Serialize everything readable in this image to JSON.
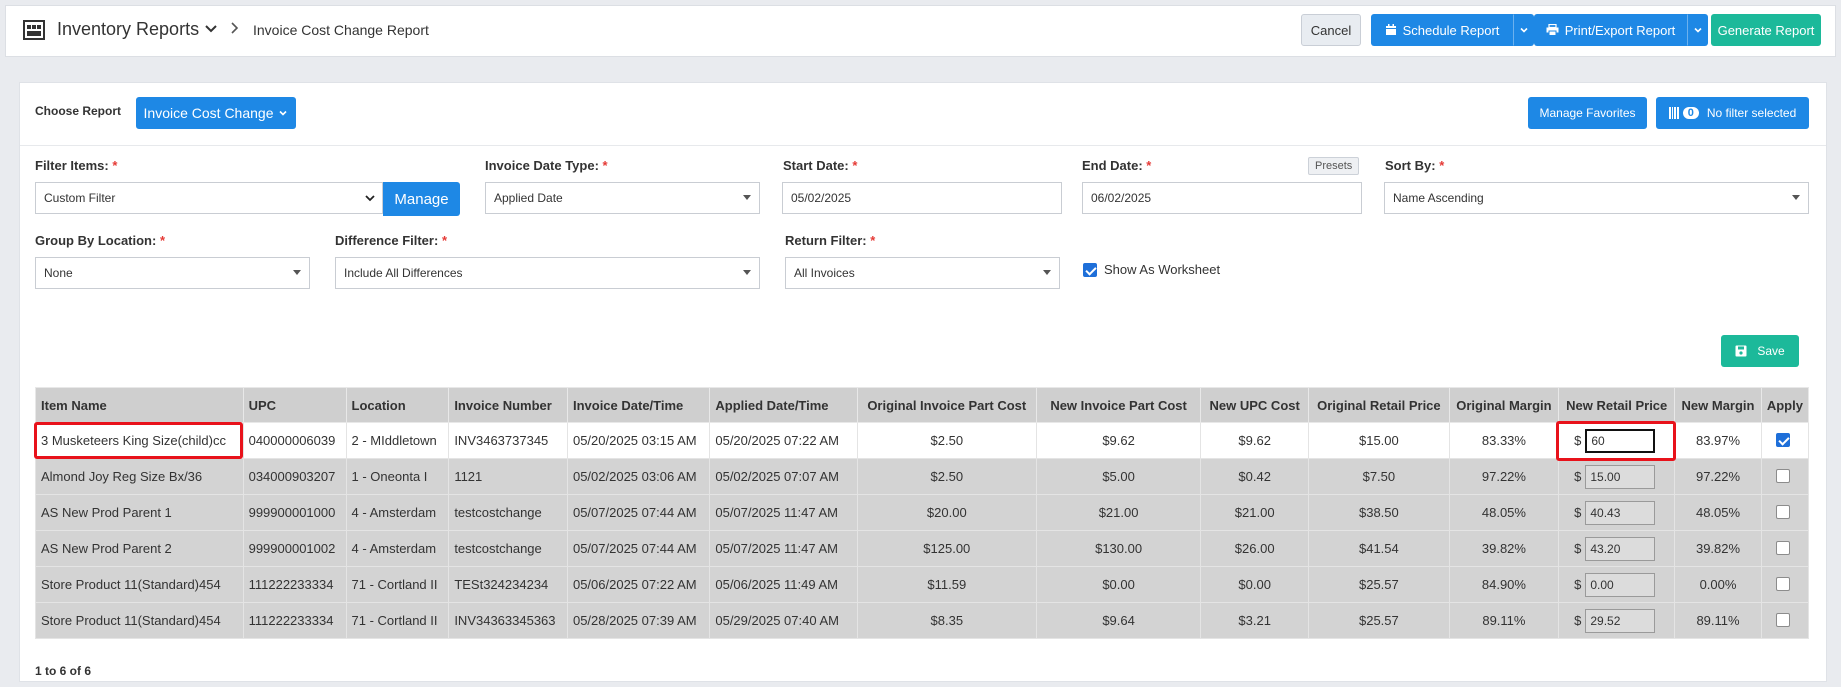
{
  "header": {
    "app_title": "Inventory Reports",
    "breadcrumb": "Invoice Cost Change Report",
    "cancel_label": "Cancel",
    "schedule_label": "Schedule Report",
    "print_label": "Print/Export Report",
    "generate_label": "Generate Report"
  },
  "report": {
    "choose_label": "Choose Report",
    "selected": "Invoice Cost Change",
    "manage_favorites": "Manage Favorites",
    "filter_count": "0",
    "filter_status": "No filter selected"
  },
  "filters": {
    "filter_items_label": "Filter Items:",
    "filter_items_value": "Custom Filter",
    "manage_label": "Manage",
    "invoice_date_type_label": "Invoice Date Type:",
    "invoice_date_type_value": "Applied Date",
    "start_date_label": "Start Date:",
    "start_date_value": "05/02/2025",
    "end_date_label": "End Date:",
    "end_date_value": "06/02/2025",
    "presets_label": "Presets",
    "sort_by_label": "Sort By:",
    "sort_by_value": "Name Ascending",
    "group_by_label": "Group By Location:",
    "group_by_value": "None",
    "difference_label": "Difference Filter:",
    "difference_value": "Include All Differences",
    "return_label": "Return Filter:",
    "return_value": "All Invoices",
    "worksheet_label": "Show As Worksheet",
    "required_mark": "*"
  },
  "save_label": "Save",
  "table": {
    "columns": [
      "Item Name",
      "UPC",
      "Location",
      "Invoice Number",
      "Invoice Date/Time",
      "Applied Date/Time",
      "Original Invoice Part Cost",
      "New Invoice Part Cost",
      "New UPC Cost",
      "Original Retail Price",
      "Original Margin",
      "New Retail Price",
      "New Margin",
      "Apply"
    ],
    "currency_symbol": "$",
    "rows": [
      {
        "item": "3 Musketeers King Size(child)cc",
        "upc": "040000006039",
        "location": "2 - MIddletown",
        "invoice": "INV3463737345",
        "invoice_dt": "05/20/2025 03:15 AM",
        "applied_dt": "05/20/2025 07:22 AM",
        "orig_cost": "$2.50",
        "new_cost": "$9.62",
        "upc_cost": "$9.62",
        "orig_retail": "$15.00",
        "orig_margin": "83.33%",
        "new_retail": "60",
        "new_margin": "83.97%",
        "apply": true
      },
      {
        "item": "Almond Joy Reg Size Bx/36",
        "upc": "034000903207",
        "location": "1 - Oneonta I",
        "invoice": "1121",
        "invoice_dt": "05/02/2025 03:06 AM",
        "applied_dt": "05/02/2025 07:07 AM",
        "orig_cost": "$2.50",
        "new_cost": "$5.00",
        "upc_cost": "$0.42",
        "orig_retail": "$7.50",
        "orig_margin": "97.22%",
        "new_retail": "15.00",
        "new_margin": "97.22%",
        "apply": false
      },
      {
        "item": "AS New Prod Parent 1",
        "upc": "999900001000",
        "location": "4 - Amsterdam",
        "invoice": "testcostchange",
        "invoice_dt": "05/07/2025 07:44 AM",
        "applied_dt": "05/07/2025 11:47 AM",
        "orig_cost": "$20.00",
        "new_cost": "$21.00",
        "upc_cost": "$21.00",
        "orig_retail": "$38.50",
        "orig_margin": "48.05%",
        "new_retail": "40.43",
        "new_margin": "48.05%",
        "apply": false
      },
      {
        "item": "AS New Prod Parent 2",
        "upc": "999900001002",
        "location": "4 - Amsterdam",
        "invoice": "testcostchange",
        "invoice_dt": "05/07/2025 07:44 AM",
        "applied_dt": "05/07/2025 11:47 AM",
        "orig_cost": "$125.00",
        "new_cost": "$130.00",
        "upc_cost": "$26.00",
        "orig_retail": "$41.54",
        "orig_margin": "39.82%",
        "new_retail": "43.20",
        "new_margin": "39.82%",
        "apply": false
      },
      {
        "item": "Store Product 11(Standard)454",
        "upc": "111222233334",
        "location": "71 - Cortland II",
        "invoice": "TESt324234234",
        "invoice_dt": "05/06/2025 07:22 AM",
        "applied_dt": "05/06/2025 11:49 AM",
        "orig_cost": "$11.59",
        "new_cost": "$0.00",
        "upc_cost": "$0.00",
        "orig_retail": "$25.57",
        "orig_margin": "84.90%",
        "new_retail": "0.00",
        "new_margin": "0.00%",
        "apply": false
      },
      {
        "item": "Store Product 11(Standard)454",
        "upc": "111222233334",
        "location": "71 - Cortland II",
        "invoice": "INV34363345363",
        "invoice_dt": "05/28/2025 07:39 AM",
        "applied_dt": "05/29/2025 07:40 AM",
        "orig_cost": "$8.35",
        "new_cost": "$9.64",
        "upc_cost": "$3.21",
        "orig_retail": "$25.57",
        "orig_margin": "89.11%",
        "new_retail": "29.52",
        "new_margin": "89.11%",
        "apply": false
      }
    ]
  },
  "pagination": "1 to 6 of 6",
  "colors": {
    "primary": "#1e88e5",
    "teal": "#1cb99a",
    "highlight": "#e8121b"
  }
}
